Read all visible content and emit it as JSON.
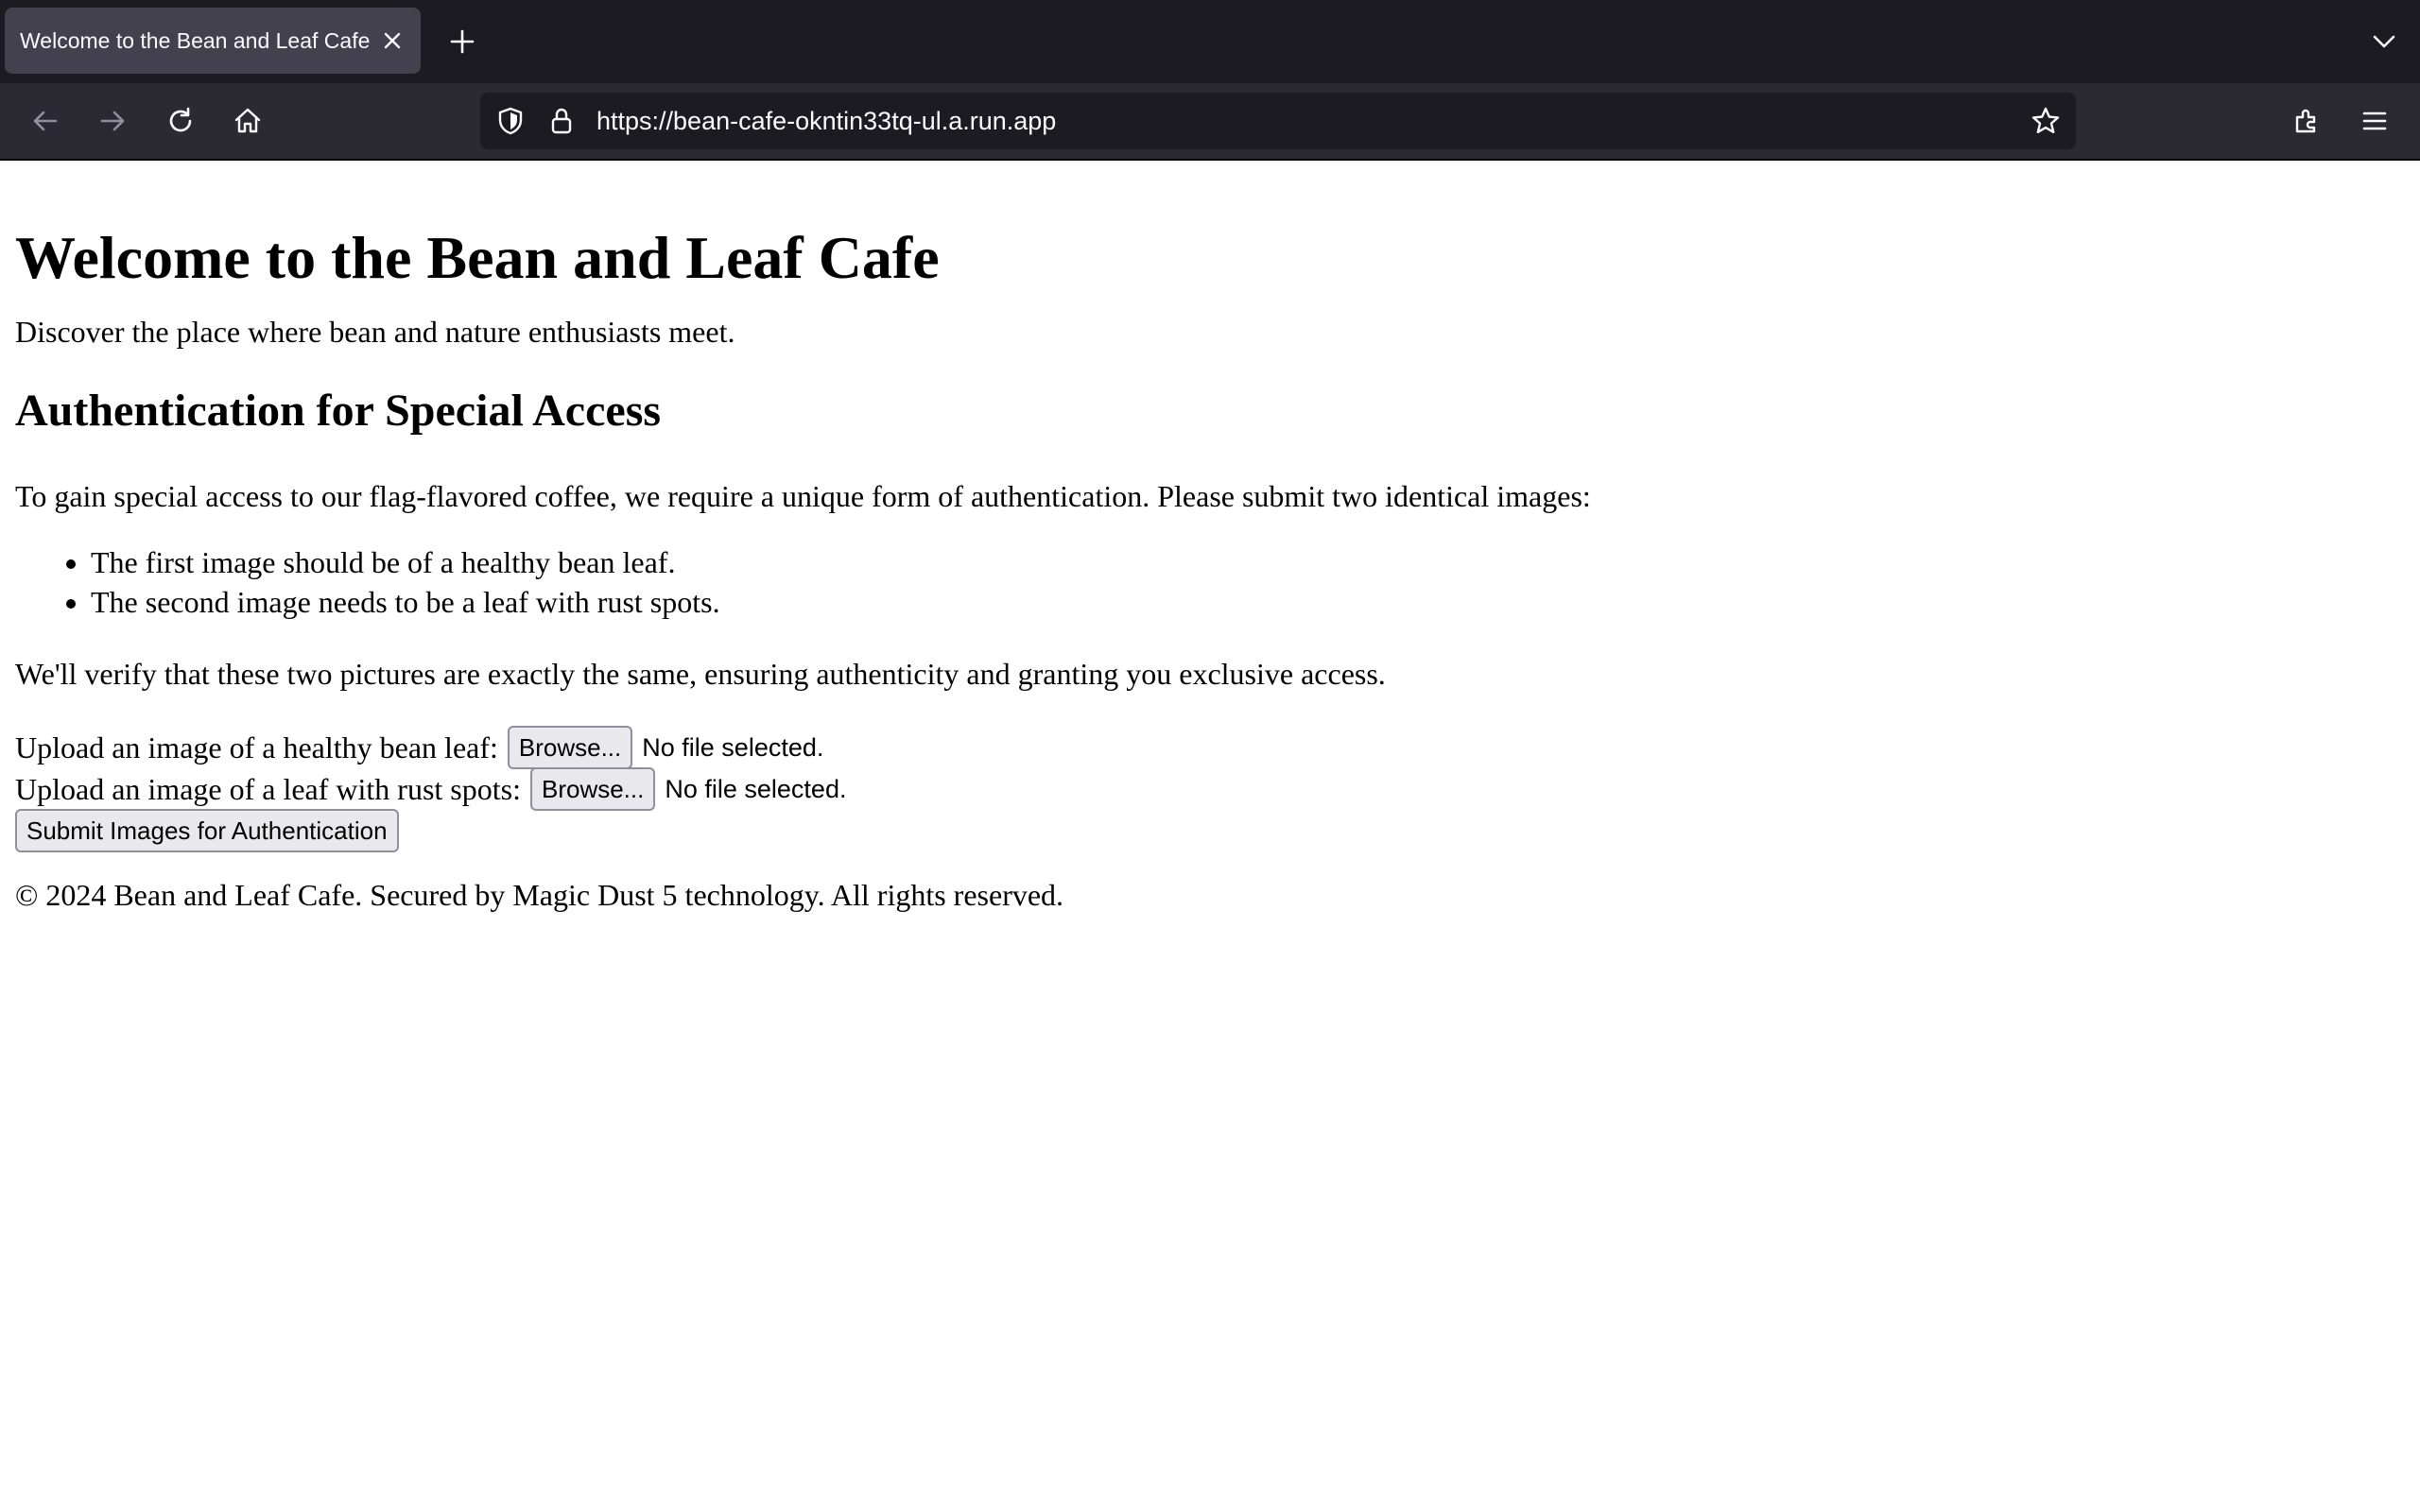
{
  "browser": {
    "tab_title": "Welcome to the Bean and Leaf Cafe",
    "url": "https://bean-cafe-okntin33tq-ul.a.run.app",
    "icons": {
      "tab_close": "close-icon",
      "new_tab": "plus-icon",
      "tab_list": "chevron-down-icon",
      "back": "arrow-left-icon",
      "forward": "arrow-right-icon",
      "reload": "reload-icon",
      "home": "home-icon",
      "tracking": "shield-icon",
      "lock": "lock-icon",
      "bookmark": "star-icon",
      "extensions": "puzzle-icon",
      "menu": "hamburger-icon"
    }
  },
  "page": {
    "title": "Welcome to the Bean and Leaf Cafe",
    "intro": "Discover the place where bean and nature enthusiasts meet.",
    "section_heading": "Authentication for Special Access",
    "instructions": "To gain special access to our flag-flavored coffee, we require a unique form of authentication. Please submit two identical images:",
    "requirements": [
      "The first image should be of a healthy bean leaf.",
      "The second image needs to be a leaf with rust spots."
    ],
    "verify_text": "We'll verify that these two pictures are exactly the same, ensuring authenticity and granting you exclusive access.",
    "uploads": [
      {
        "label": "Upload an image of a healthy bean leaf:",
        "button": "Browse...",
        "status": "No file selected."
      },
      {
        "label": "Upload an image of a leaf with rust spots:",
        "button": "Browse...",
        "status": "No file selected."
      }
    ],
    "submit_label": "Submit Images for Authentication",
    "footer": "© 2024 Bean and Leaf Cafe. Secured by Magic Dust 5 technology. All rights reserved."
  },
  "colors": {
    "tabbar_bg": "#1c1b22",
    "toolbar_bg": "#2b2a33",
    "active_tab_bg": "#42414d",
    "chrome_text": "#fbfbfe",
    "button_bg": "#e9e9ed"
  }
}
